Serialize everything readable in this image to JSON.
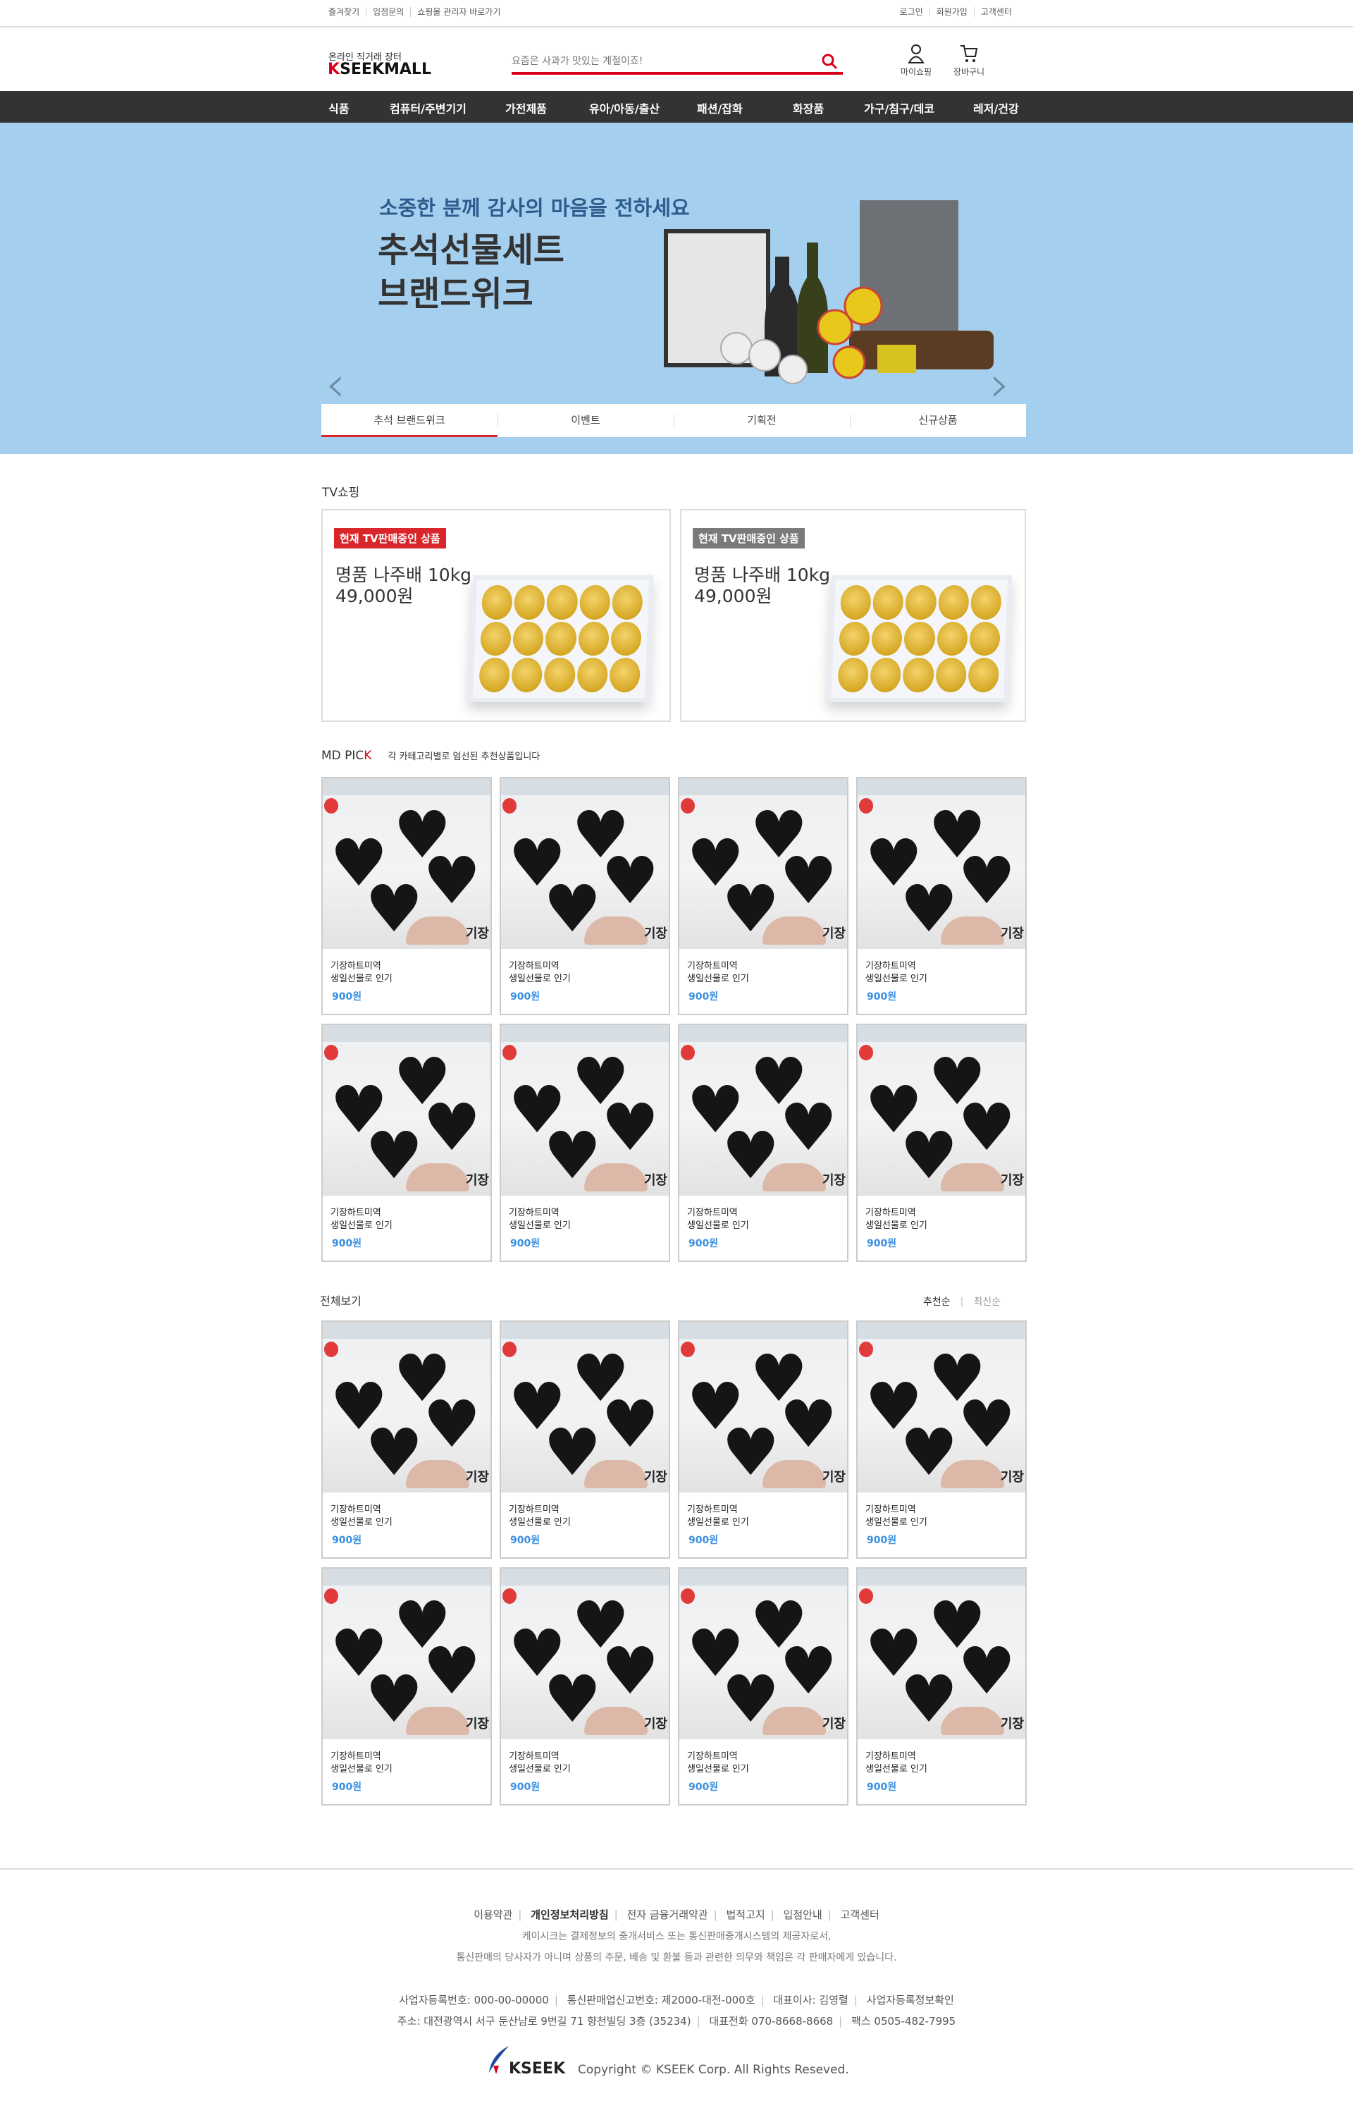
{
  "topbar": {
    "left": [
      "즐겨찾기",
      "입점문의",
      "쇼핑몰 관리자 바로가기"
    ],
    "right": [
      "로그인",
      "회원가입",
      "고객센터"
    ]
  },
  "header": {
    "logo_sub": "온라인 직거래 장터",
    "logo_k": "K",
    "logo_rest": "SEEKMALL",
    "search_placeholder": "요즘은 사과가 맛있는 계절이죠!",
    "mypage": "마이쇼핑",
    "cart": "장바구니"
  },
  "nav": [
    "식품",
    "컴퓨터/주변기기",
    "가전제품",
    "유아/아동/출산",
    "패션/잡화",
    "화장품",
    "가구/침구/데코",
    "레저/건강"
  ],
  "banner": {
    "subtitle": "소중한 분께 감사의 마음을 전하세요",
    "title": "추석선물세트\n브랜드위크",
    "tabs": [
      "추석 브랜드위크",
      "이벤트",
      "기획전",
      "신규상품"
    ]
  },
  "tv": {
    "title": "TV쇼핑",
    "cards": [
      {
        "badge": "현재 TV판매중인 상품",
        "badge_color": "#d9262a",
        "name": "명품 나주배 10kg",
        "price": "49,000원"
      },
      {
        "badge": "현재 TV판매중인 상품",
        "badge_color": "#7a7a7a",
        "name": "명품 나주배 10kg",
        "price": "49,000원"
      }
    ]
  },
  "mdpick": {
    "title_a": "MD PIC",
    "title_b": "K",
    "desc": "각 카테고리별로 엄선된 추천상품입니다",
    "products": [
      {
        "name1": "기장하트미역",
        "name2": "생일선물로 인기",
        "price": "900원"
      },
      {
        "name1": "기장하트미역",
        "name2": "생일선물로 인기",
        "price": "900원"
      },
      {
        "name1": "기장하트미역",
        "name2": "생일선물로 인기",
        "price": "900원"
      },
      {
        "name1": "기장하트미역",
        "name2": "생일선물로 인기",
        "price": "900원"
      },
      {
        "name1": "기장하트미역",
        "name2": "생일선물로 인기",
        "price": "900원"
      },
      {
        "name1": "기장하트미역",
        "name2": "생일선물로 인기",
        "price": "900원"
      },
      {
        "name1": "기장하트미역",
        "name2": "생일선물로 인기",
        "price": "900원"
      },
      {
        "name1": "기장하트미역",
        "name2": "생일선물로 인기",
        "price": "900원"
      }
    ]
  },
  "all": {
    "title": "전체보기",
    "sort": [
      "추천순",
      "최신순"
    ],
    "products": [
      {
        "name1": "기장하트미역",
        "name2": "생일선물로 인기",
        "price": "900원"
      },
      {
        "name1": "기장하트미역",
        "name2": "생일선물로 인기",
        "price": "900원"
      },
      {
        "name1": "기장하트미역",
        "name2": "생일선물로 인기",
        "price": "900원"
      },
      {
        "name1": "기장하트미역",
        "name2": "생일선물로 인기",
        "price": "900원"
      },
      {
        "name1": "기장하트미역",
        "name2": "생일선물로 인기",
        "price": "900원"
      },
      {
        "name1": "기장하트미역",
        "name2": "생일선물로 인기",
        "price": "900원"
      },
      {
        "name1": "기장하트미역",
        "name2": "생일선물로 인기",
        "price": "900원"
      },
      {
        "name1": "기장하트미역",
        "name2": "생일선물로 인기",
        "price": "900원"
      }
    ]
  },
  "footer": {
    "links": [
      "이용약관",
      "개인정보처리방침",
      "전자 금융거래약관",
      "법적고지",
      "입점안내",
      "고객센터"
    ],
    "notice1": "케이시크는 결제정보의 중개서비스 또는 통신판매중개시스템의 제공자로서,",
    "notice2": "통신판매의 당사자가 아니며 상품의 주문, 배송 및 환불 등과 관련한 의무와 책임은 각 판매자에게 있습니다.",
    "info1": [
      "사업자등록번호: 000-00-00000",
      "통신판매업신고번호: 제2000-대전-000호",
      "대표이사: 김영렬",
      "사업자등록정보확인"
    ],
    "info2": [
      "주소: 대전광역시 서구 둔산남로 9번길 71  향천빌딩 3층  (35234)",
      "대표전화 070-8668-8668",
      "팩스  0505-482-7995"
    ],
    "logo": "KSEEK",
    "copyright": "Copyright © KSEEK  Corp. All Rights Reseved."
  },
  "colors": {
    "accent": "#d9001b",
    "nav": "#333333",
    "banner": "#a5cfee",
    "price": "#3a8fe0"
  }
}
